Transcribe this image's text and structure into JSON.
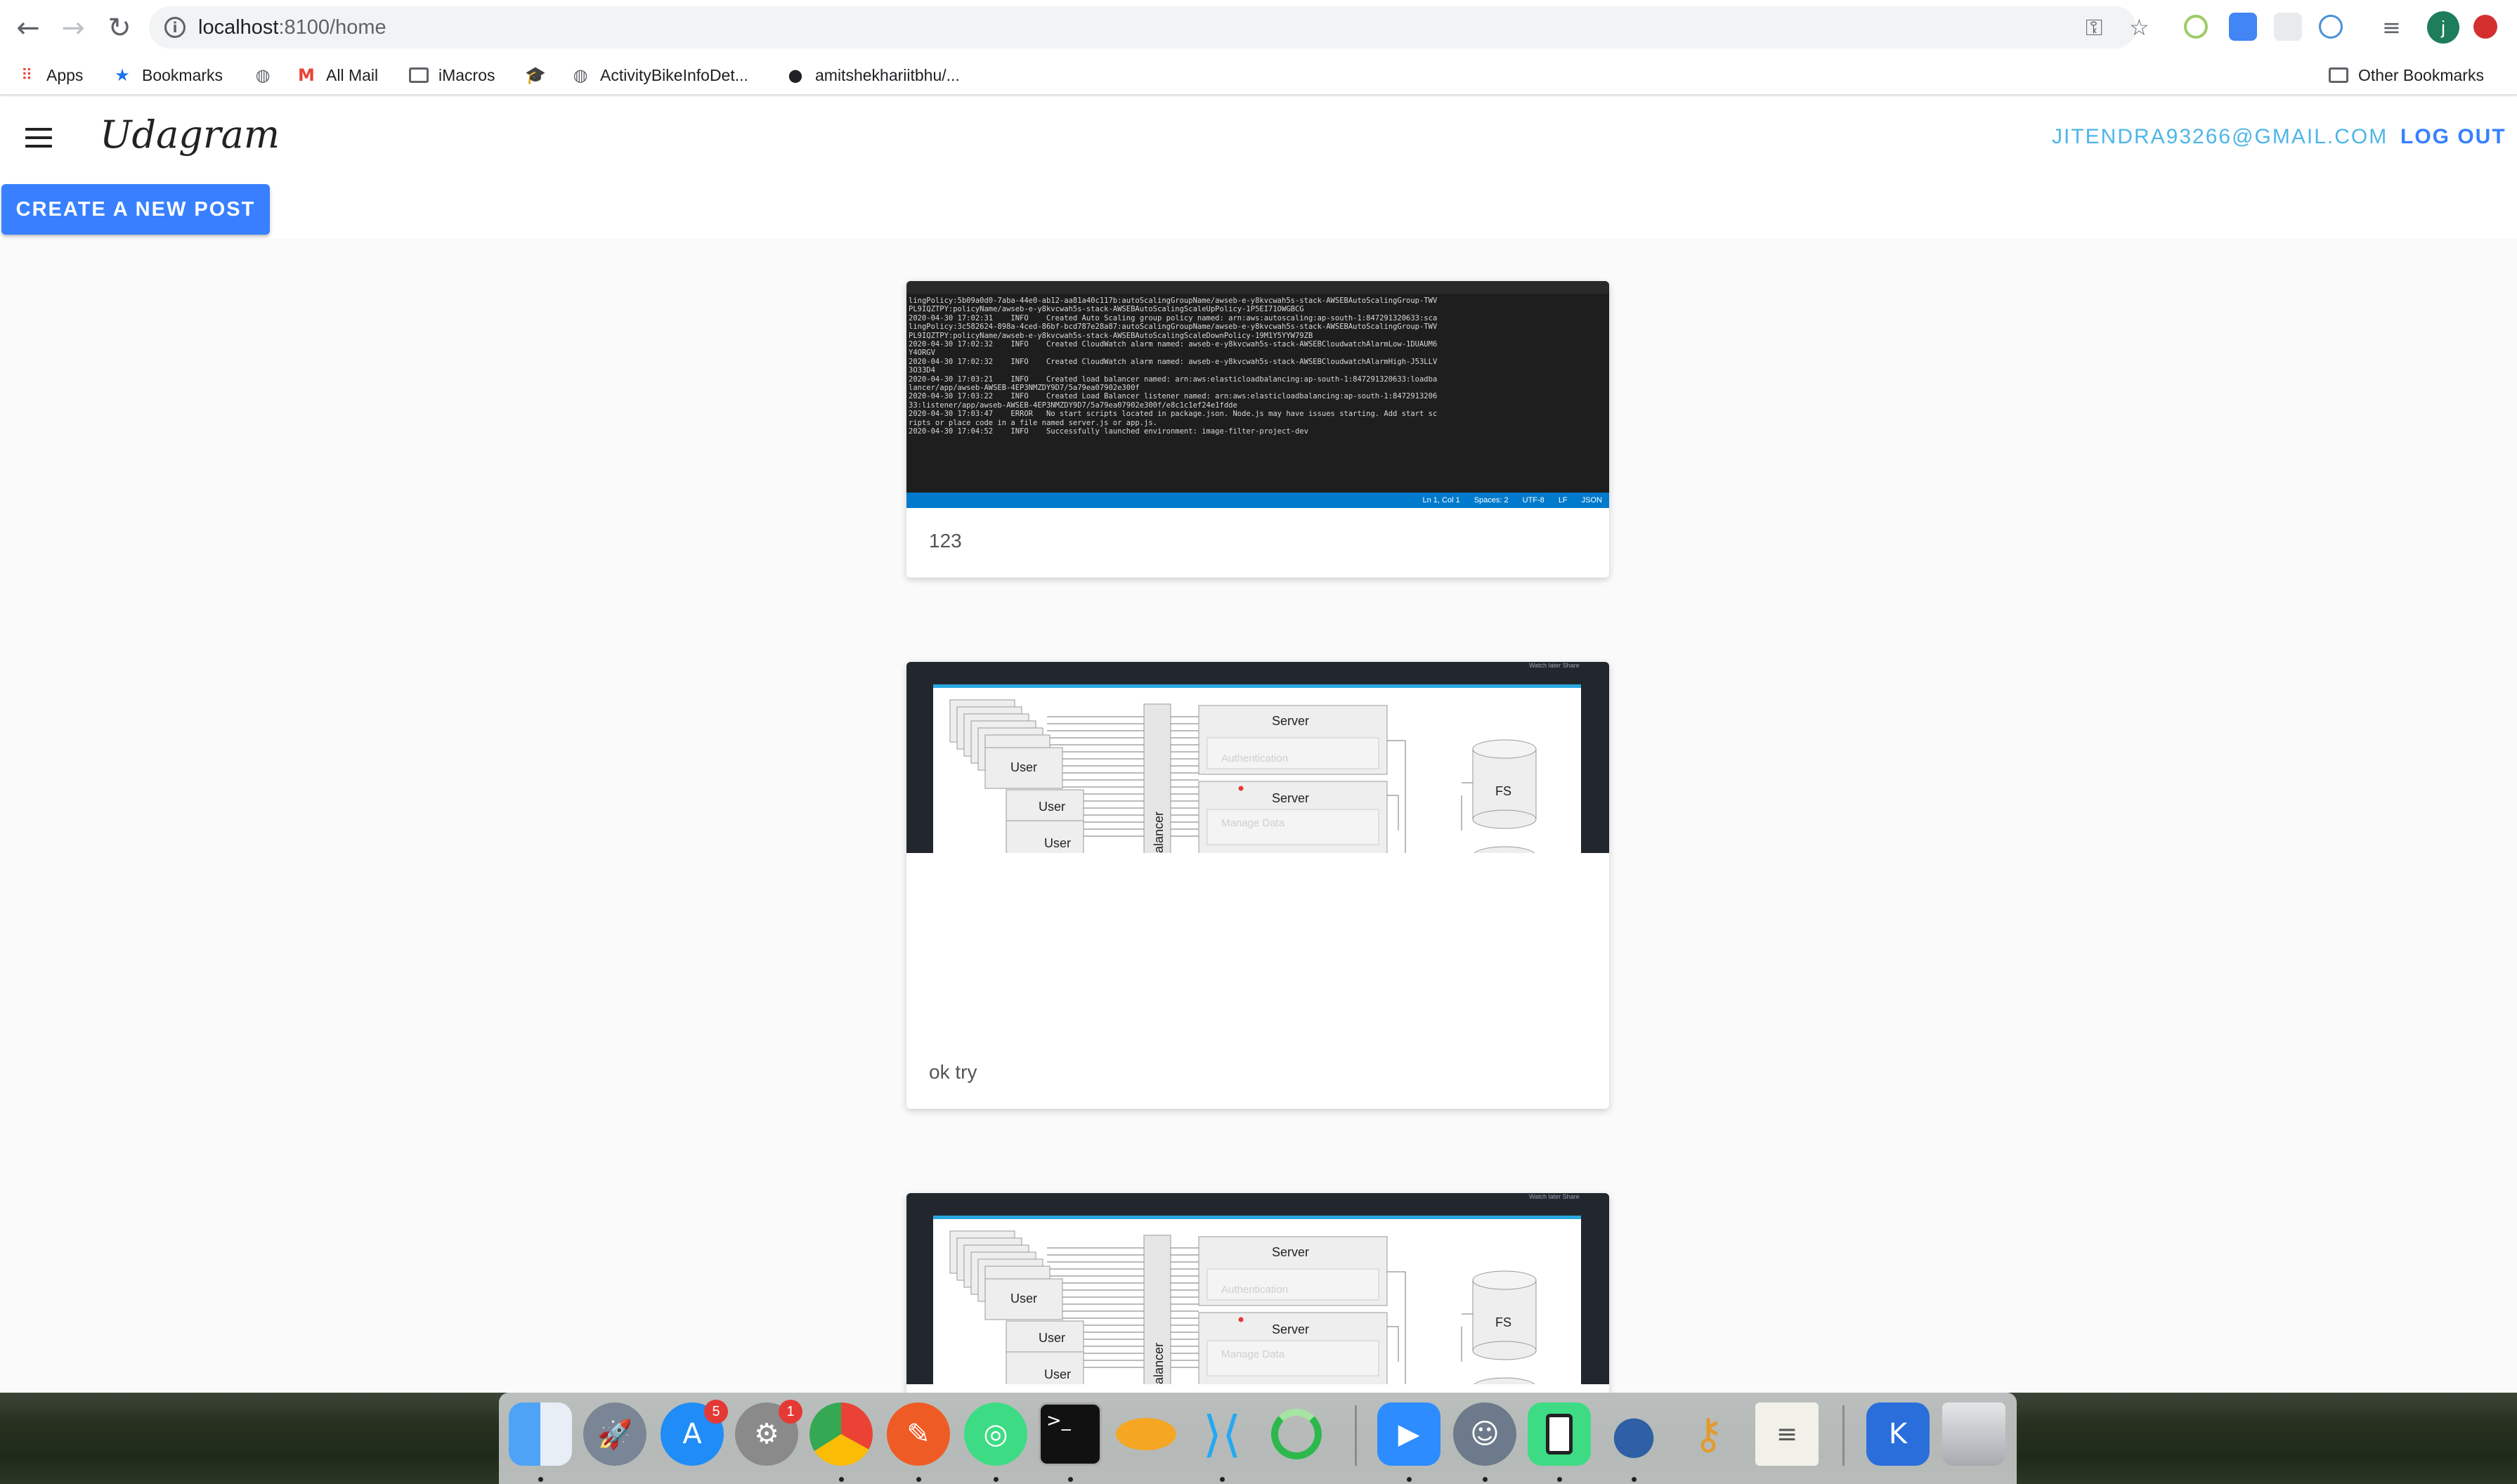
{
  "browser": {
    "url_host": "localhost",
    "url_path": ":8100/home",
    "profile_initial": "j",
    "bookmarks": [
      {
        "label": "Apps"
      },
      {
        "label": "Bookmarks"
      },
      {
        "label": "All Mail"
      },
      {
        "label": "iMacros"
      },
      {
        "label": "ActivityBikeInfoDet..."
      },
      {
        "label": "amitshekhariitbhu/..."
      }
    ],
    "other_bookmarks": "Other Bookmarks"
  },
  "app": {
    "brand": "Udagram",
    "user_email": "JITENDRA93266@GMAIL.COM",
    "logout_label": "LOG OUT",
    "create_post_label": "CREATE A NEW POST"
  },
  "feed": [
    {
      "caption": "123",
      "terminal_lines": [
        "lingPolicy:5b09a0d0-7aba-44e0-ab12-aa81a40c117b:autoScalingGroupName/awseb-e-y8kvcwah5s-stack-AWSEBAutoScalingGroup-TWV",
        "PL9IQZTPY:policyName/awseb-e-y8kvcwah5s-stack-AWSEBAutoScalingScaleUpPolicy-1P5EI71OWGBCG",
        "2020-04-30 17:02:31    INFO    Created Auto Scaling group policy named: arn:aws:autoscaling:ap-south-1:847291320633:sca",
        "lingPolicy:3c582624-898a-4ced-86bf-bcd787e28a87:autoScalingGroupName/awseb-e-y8kvcwah5s-stack-AWSEBAutoScalingGroup-TWV",
        "PL9IQZTPY:policyName/awseb-e-y8kvcwah5s-stack-AWSEBAutoScalingScaleDownPolicy-19M1Y5YYW79ZB",
        "2020-04-30 17:02:32    INFO    Created CloudWatch alarm named: awseb-e-y8kvcwah5s-stack-AWSEBCloudwatchAlarmLow-1DUAUM6",
        "Y4ORGV",
        "2020-04-30 17:02:32    INFO    Created CloudWatch alarm named: awseb-e-y8kvcwah5s-stack-AWSEBCloudwatchAlarmHigh-J53LLV",
        "3O33D4",
        "2020-04-30 17:03:21    INFO    Created load balancer named: arn:aws:elasticloadbalancing:ap-south-1:847291320633:loadba",
        "lancer/app/awseb-AWSEB-4EP3NMZDY9D7/5a79ea07902e300f",
        "2020-04-30 17:03:22    INFO    Created Load Balancer listener named: arn:aws:elasticloadbalancing:ap-south-1:8472913206",
        "33:listener/app/awseb-AWSEB-4EP3NMZDY9D7/5a79ea07902e300f/e8c1c1ef24e1fdde",
        "2020-04-30 17:03:47    ERROR   No start scripts located in package.json. Node.js may have issues starting. Add start sc",
        "ripts or place code in a file named server.js or app.js.",
        "2020-04-30 17:04:52    INFO    Successfully launched environment: image-filter-project-dev"
      ],
      "status_bar": [
        "Ln 1, Col 1",
        "Spaces: 2",
        "UTF-8",
        "LF",
        "JSON"
      ]
    },
    {
      "caption": "ok try",
      "diagram": {
        "top_links": "Watch later   Share",
        "user_label": "User",
        "balancer_label": "alancer",
        "server_label": "Server",
        "auth_label": "Authentication",
        "manage_label": "Manage Data",
        "fs_label": "FS"
      }
    },
    {
      "caption": "",
      "diagram": {
        "top_links": "Watch later   Share",
        "user_label": "User",
        "balancer_label": "alancer",
        "server_label": "Server",
        "auth_label": "Authentication",
        "manage_label": "Manage Data",
        "fs_label": "FS"
      }
    }
  ],
  "dock": {
    "app_store_badge": "5",
    "settings_badge": "1",
    "items": [
      "finder",
      "launchpad",
      "app-store",
      "system-preferences",
      "chrome",
      "postman",
      "android-studio",
      "terminal",
      "blimp",
      "vscode",
      "loader",
      "zoom",
      "sequel-pro",
      "device",
      "tableplus",
      "keychain",
      "textedit",
      "kite",
      "trash"
    ]
  }
}
